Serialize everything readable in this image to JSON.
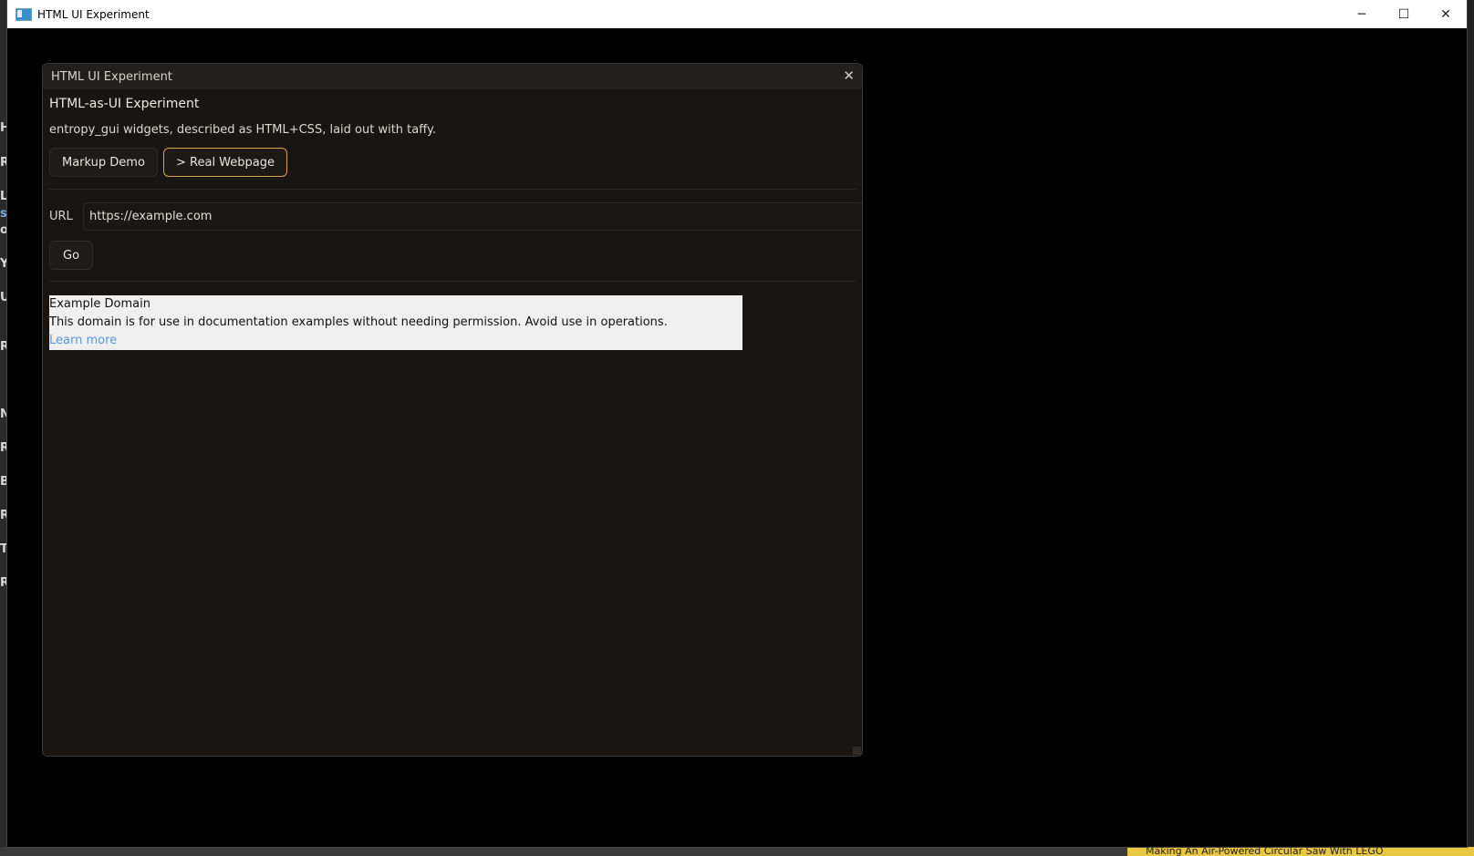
{
  "os_window": {
    "title": "HTML UI Experiment",
    "controls": {
      "minimize": "─",
      "maximize": "☐",
      "close": "✕"
    }
  },
  "background": {
    "left_letters": [
      "H",
      "R",
      "L",
      "s",
      "o",
      "Y",
      "U",
      "R",
      "N",
      "R",
      "B",
      "R",
      "T",
      "R"
    ],
    "bottom_video_title": "Making An Air-Powered Circular Saw With LEGO"
  },
  "panel": {
    "title": "HTML UI Experiment",
    "close_glyph": "✕",
    "heading": "HTML-as-UI Experiment",
    "description": "entropy_gui widgets, described as HTML+CSS, laid out with taffy.",
    "buttons": {
      "markup_demo": "Markup Demo",
      "real_webpage": "> Real Webpage"
    },
    "url_label": "URL",
    "url_value": "https://example.com",
    "go_label": "Go"
  },
  "webpage": {
    "heading": "Example Domain",
    "body": "This domain is for use in documentation examples without needing permission. Avoid use in operations.",
    "link": "Learn more"
  },
  "colors": {
    "accent": "#d6a449",
    "panel_bg": "#181512",
    "link": "#5a96d6"
  }
}
